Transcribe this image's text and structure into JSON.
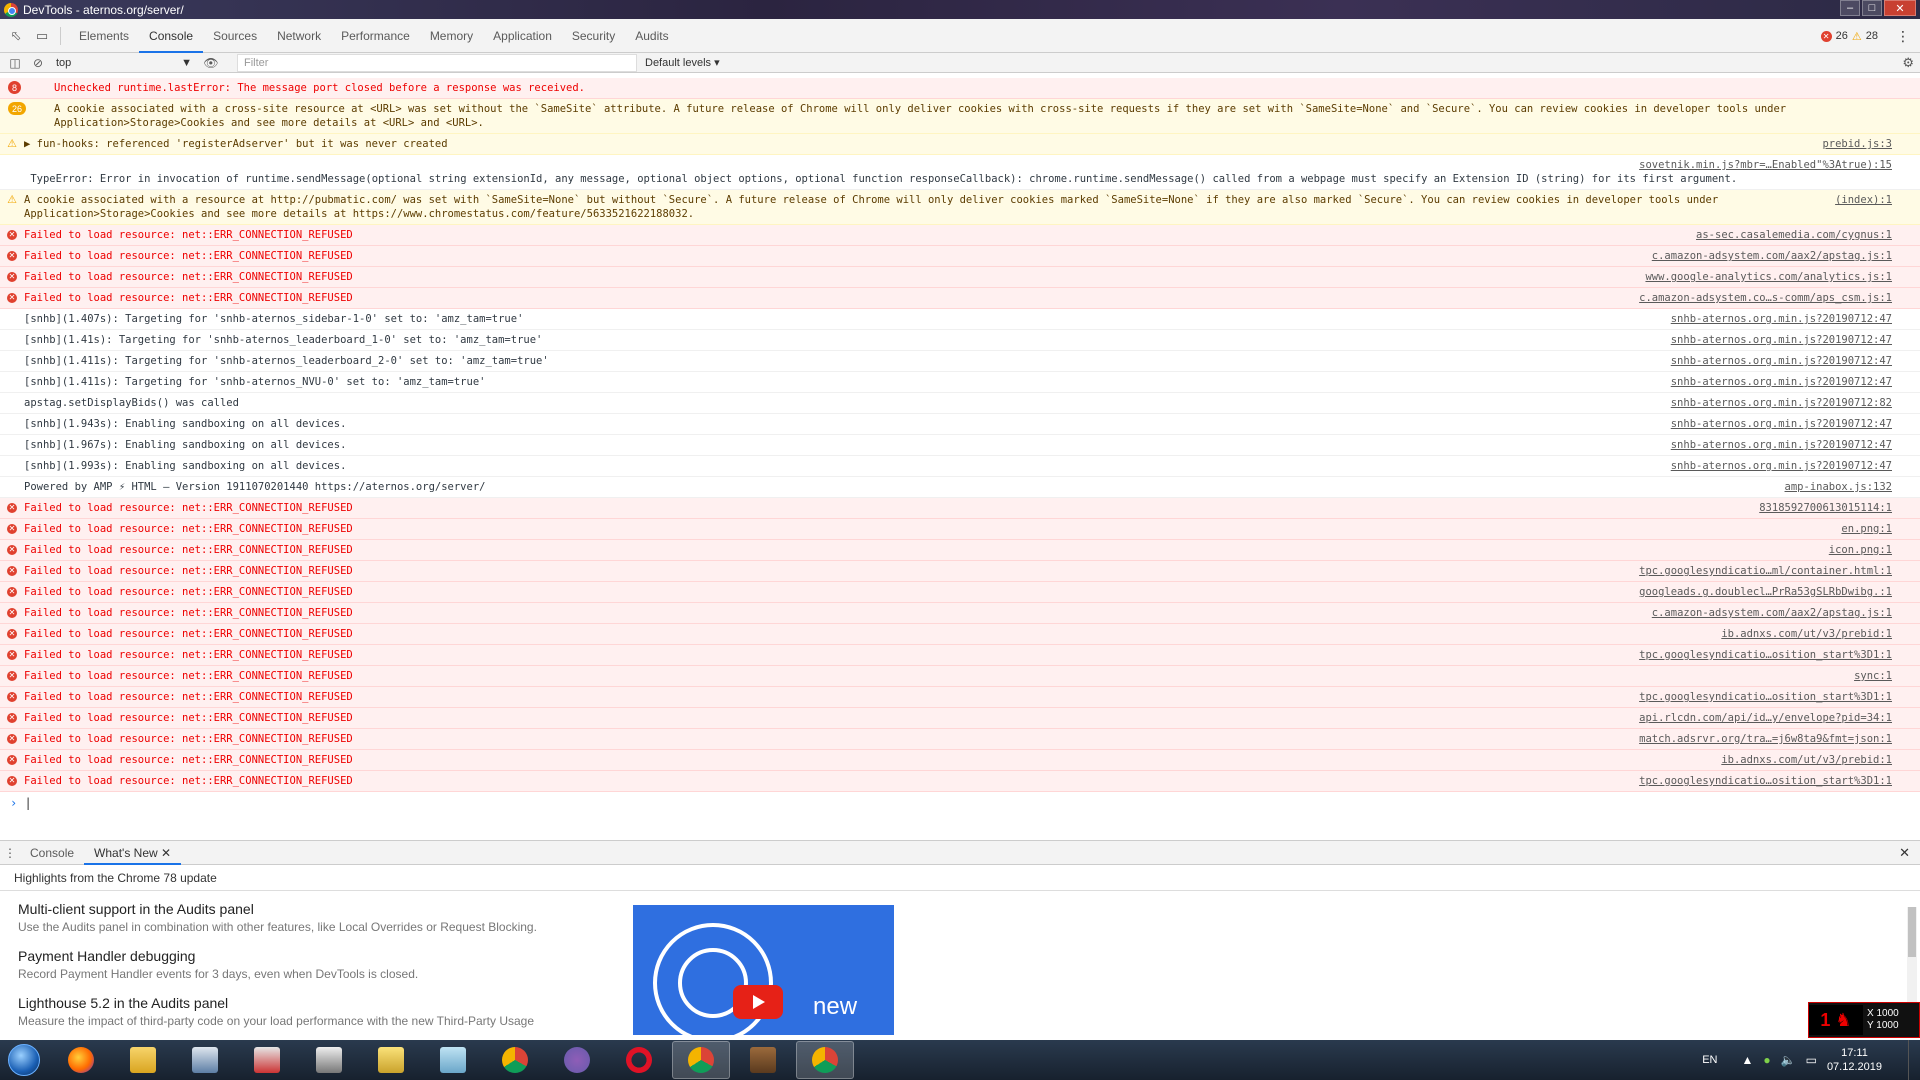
{
  "window": {
    "title": "DevTools - aternos.org/server/"
  },
  "tabs": [
    "Elements",
    "Console",
    "Sources",
    "Network",
    "Performance",
    "Memory",
    "Application",
    "Security",
    "Audits"
  ],
  "active_tab": "Console",
  "counts": {
    "errors": "26",
    "warnings": "28"
  },
  "toolbar": {
    "context": "top",
    "filter_placeholder": "Filter",
    "levels": "Default levels"
  },
  "console_rows": [
    {
      "type": "err",
      "count": "8",
      "msg": "Unchecked runtime.lastError: The message port closed before a response was received.",
      "src": ""
    },
    {
      "type": "warn",
      "count": "26",
      "msg": "A cookie associated with a cross-site resource at <URL> was set without the `SameSite` attribute. A future release of Chrome will only deliver cookies with cross-site requests if they are set with `SameSite=None` and `Secure`. You can review cookies in developer tools under\nApplication>Storage>Cookies and see more details at <URL> and <URL>.",
      "src": ""
    },
    {
      "type": "warn",
      "msg": "▶ fun-hooks: referenced 'registerAdserver' but it was never created",
      "src": "prebid.js:3"
    },
    {
      "type": "info",
      "msg": "\n TypeError: Error in invocation of runtime.sendMessage(optional string extensionId, any message, optional object options, optional function responseCallback): chrome.runtime.sendMessage() called from a webpage must specify an Extension ID (string) for its first argument.",
      "src": "sovetnik.min.js?mbr=…Enabled\"%3Atrue):15"
    },
    {
      "type": "warn",
      "msg": "A cookie associated with a resource at http://pubmatic.com/ was set with `SameSite=None` but without `Secure`. A future release of Chrome will only deliver cookies marked `SameSite=None` if they are also marked `Secure`. You can review cookies in developer tools under\nApplication>Storage>Cookies and see more details at https://www.chromestatus.com/feature/5633521622188032.",
      "src": "(index):1"
    },
    {
      "type": "err",
      "msg": "Failed to load resource: net::ERR_CONNECTION_REFUSED",
      "src": "as-sec.casalemedia.com/cygnus:1"
    },
    {
      "type": "err",
      "msg": "Failed to load resource: net::ERR_CONNECTION_REFUSED",
      "src": "c.amazon-adsystem.com/aax2/apstag.js:1"
    },
    {
      "type": "err",
      "msg": "Failed to load resource: net::ERR_CONNECTION_REFUSED",
      "src": "www.google-analytics.com/analytics.js:1"
    },
    {
      "type": "err",
      "msg": "Failed to load resource: net::ERR_CONNECTION_REFUSED",
      "src": "c.amazon-adsystem.co…s-comm/aps_csm.js:1"
    },
    {
      "type": "info",
      "msg": "[snhb](1.407s): Targeting for 'snhb-aternos_sidebar-1-0' set to: 'amz_tam=true'",
      "src": "snhb-aternos.org.min.js?20190712:47"
    },
    {
      "type": "info",
      "msg": "[snhb](1.41s): Targeting for 'snhb-aternos_leaderboard_1-0' set to: 'amz_tam=true'",
      "src": "snhb-aternos.org.min.js?20190712:47"
    },
    {
      "type": "info",
      "msg": "[snhb](1.411s): Targeting for 'snhb-aternos_leaderboard_2-0' set to: 'amz_tam=true'",
      "src": "snhb-aternos.org.min.js?20190712:47"
    },
    {
      "type": "info",
      "msg": "[snhb](1.411s): Targeting for 'snhb-aternos_NVU-0' set to: 'amz_tam=true'",
      "src": "snhb-aternos.org.min.js?20190712:47"
    },
    {
      "type": "info",
      "msg": "apstag.setDisplayBids() was called",
      "src": "snhb-aternos.org.min.js?20190712:82"
    },
    {
      "type": "info",
      "msg": "[snhb](1.943s): Enabling sandboxing on all devices.",
      "src": "snhb-aternos.org.min.js?20190712:47"
    },
    {
      "type": "info",
      "msg": "[snhb](1.967s): Enabling sandboxing on all devices.",
      "src": "snhb-aternos.org.min.js?20190712:47"
    },
    {
      "type": "info",
      "msg": "[snhb](1.993s): Enabling sandboxing on all devices.",
      "src": "snhb-aternos.org.min.js?20190712:47"
    },
    {
      "type": "info",
      "msg": "Powered by AMP ⚡ HTML – Version 1911070201440 https://aternos.org/server/",
      "src": "amp-inabox.js:132"
    },
    {
      "type": "err",
      "msg": "Failed to load resource: net::ERR_CONNECTION_REFUSED",
      "src": "8318592700613015114:1"
    },
    {
      "type": "err",
      "msg": "Failed to load resource: net::ERR_CONNECTION_REFUSED",
      "src": "en.png:1"
    },
    {
      "type": "err",
      "msg": "Failed to load resource: net::ERR_CONNECTION_REFUSED",
      "src": "icon.png:1"
    },
    {
      "type": "err",
      "msg": "Failed to load resource: net::ERR_CONNECTION_REFUSED",
      "src": "tpc.googlesyndicatio…ml/container.html:1"
    },
    {
      "type": "err",
      "msg": "Failed to load resource: net::ERR_CONNECTION_REFUSED",
      "src": "googleads.g.doublecl…PrRa53gSLRbDwibg.:1"
    },
    {
      "type": "err",
      "msg": "Failed to load resource: net::ERR_CONNECTION_REFUSED",
      "src": "c.amazon-adsystem.com/aax2/apstag.js:1"
    },
    {
      "type": "err",
      "msg": "Failed to load resource: net::ERR_CONNECTION_REFUSED",
      "src": "ib.adnxs.com/ut/v3/prebid:1"
    },
    {
      "type": "err",
      "msg": "Failed to load resource: net::ERR_CONNECTION_REFUSED",
      "src": "tpc.googlesyndicatio…osition_start%3D1:1"
    },
    {
      "type": "err",
      "msg": "Failed to load resource: net::ERR_CONNECTION_REFUSED",
      "src": "sync:1"
    },
    {
      "type": "err",
      "msg": "Failed to load resource: net::ERR_CONNECTION_REFUSED",
      "src": "tpc.googlesyndicatio…osition_start%3D1:1"
    },
    {
      "type": "err",
      "msg": "Failed to load resource: net::ERR_CONNECTION_REFUSED",
      "src": "api.rlcdn.com/api/id…y/envelope?pid=34:1"
    },
    {
      "type": "err",
      "msg": "Failed to load resource: net::ERR_CONNECTION_REFUSED",
      "src": "match.adsrvr.org/tra…=j6w8ta9&fmt=json:1"
    },
    {
      "type": "err",
      "msg": "Failed to load resource: net::ERR_CONNECTION_REFUSED",
      "src": "ib.adnxs.com/ut/v3/prebid:1"
    },
    {
      "type": "err",
      "msg": "Failed to load resource: net::ERR_CONNECTION_REFUSED",
      "src": "tpc.googlesyndicatio…osition_start%3D1:1"
    }
  ],
  "drawer": {
    "tabs": [
      "Console",
      "What's New"
    ],
    "highlights": "Highlights from the Chrome 78 update",
    "items": [
      {
        "title": "Multi-client support in the Audits panel",
        "desc": "Use the Audits panel in combination with other features, like Local Overrides or Request Blocking."
      },
      {
        "title": "Payment Handler debugging",
        "desc": "Record Payment Handler events for 3 days, even when DevTools is closed."
      },
      {
        "title": "Lighthouse 5.2 in the Audits panel",
        "desc": "Measure the impact of third-party code on your load performance with the new Third-Party Usage"
      }
    ],
    "promo_label": "new"
  },
  "overlay": {
    "x": "X 1000",
    "y": "Y 1000"
  },
  "taskbar": {
    "apps": [
      "firefox-icon",
      "explorer-icon",
      "app-icon",
      "snipping-icon",
      "calculator-icon",
      "folder-icon",
      "paint-icon",
      "chrome-icon",
      "viber-icon",
      "opera-icon",
      "chrome-icon",
      "minecraft-icon",
      "chrome-icon"
    ],
    "lang": "EN",
    "time": "17:11",
    "date": "07.12.2019"
  },
  "colors": {
    "error": "#e00000",
    "warning": "#f2a600",
    "accent": "#1a73e8"
  }
}
